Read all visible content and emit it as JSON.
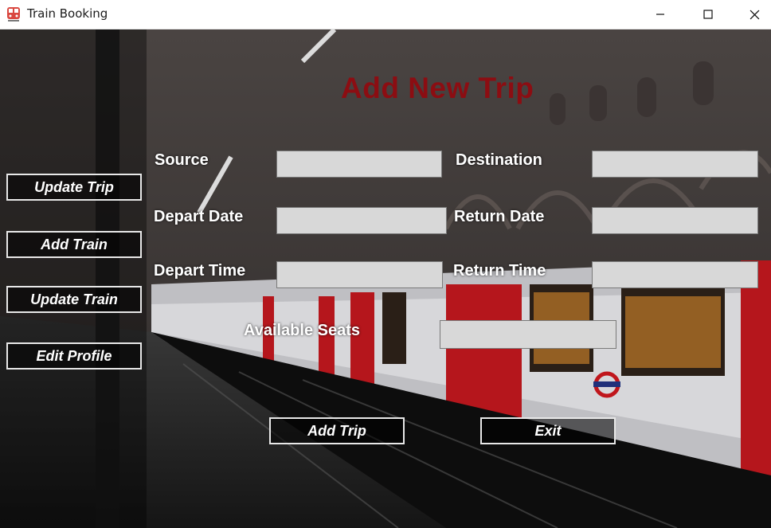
{
  "window": {
    "title": "Train Booking"
  },
  "page": {
    "title": "Add New Trip"
  },
  "sidebar": {
    "items": [
      {
        "label": "Update Trip"
      },
      {
        "label": "Add Train"
      },
      {
        "label": "Update Train"
      },
      {
        "label": "Edit Profile"
      }
    ]
  },
  "form": {
    "source": {
      "label": "Source",
      "value": ""
    },
    "destination": {
      "label": "Destination",
      "value": ""
    },
    "depart_date": {
      "label": "Depart Date",
      "value": ""
    },
    "return_date": {
      "label": "Return Date",
      "value": ""
    },
    "depart_time": {
      "label": "Depart Time",
      "value": ""
    },
    "return_time": {
      "label": "Return Time",
      "value": ""
    },
    "available_seats": {
      "label": "Available Seats",
      "value": ""
    }
  },
  "actions": {
    "add_trip": "Add Trip",
    "exit": "Exit"
  },
  "colors": {
    "title": "#8c0d12",
    "input_bg": "#d8d8d8",
    "button_border": "#e8e8e8"
  },
  "icons": {
    "app": "train-icon",
    "minimize": "minimize-icon",
    "maximize": "maximize-icon",
    "close": "close-icon"
  }
}
